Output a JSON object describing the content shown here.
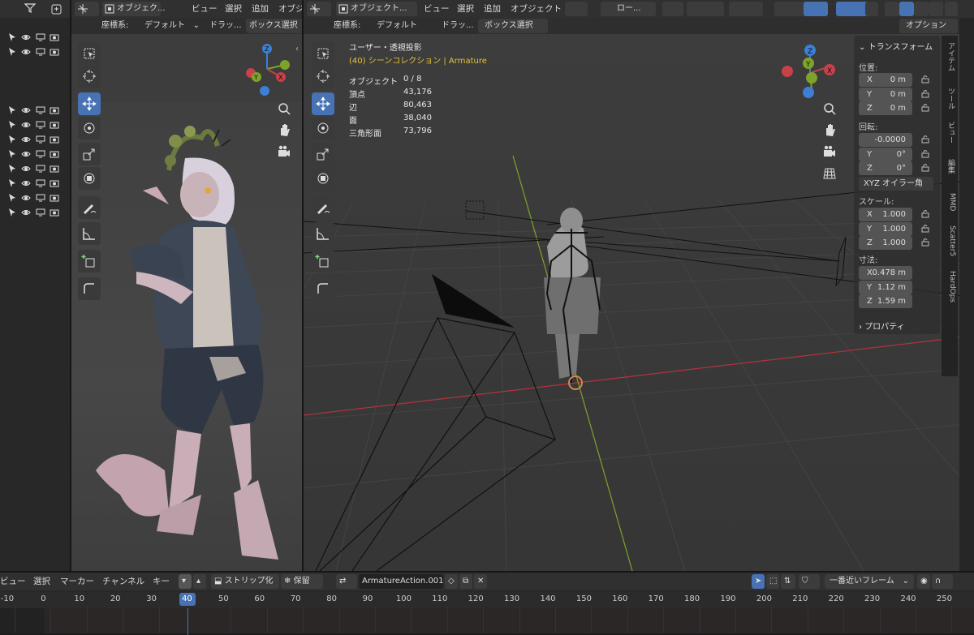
{
  "left_view": {
    "header": {
      "object_mode": "オブジェク...",
      "menu_view": "ビュー",
      "menu_select": "選択",
      "menu_add": "追加",
      "menu_object": "オブジ"
    },
    "tool_header": {
      "coord_label": "座標系:",
      "coord_value": "デフォルト",
      "drag_label": "ドラッ...",
      "drag_value": "ボックス選択"
    }
  },
  "right_view": {
    "header": {
      "object_mode": "オブジェクト...",
      "menu_view": "ビュー",
      "menu_select": "選択",
      "menu_add": "追加",
      "menu_object": "オブジェクト",
      "pivot": "ロー..."
    },
    "tool_header": {
      "coord_label": "座標系:",
      "coord_value": "デフォルト",
      "drag_label": "ドラッ...",
      "drag_value": "ボックス選択",
      "options": "オプション"
    },
    "overlay": {
      "view_name": "ユーザー・透視投影",
      "collection": "(40) シーンコレクション | Armature",
      "stats": [
        {
          "label": "オブジェクト",
          "value": "0 / 8"
        },
        {
          "label": "頂点",
          "value": "43,176"
        },
        {
          "label": "辺",
          "value": "80,463"
        },
        {
          "label": "面",
          "value": "38,040"
        },
        {
          "label": "三角形面",
          "value": "73,796"
        }
      ]
    }
  },
  "n_panel": {
    "transform_title": "トランスフォーム",
    "location_label": "位置:",
    "location": [
      {
        "axis": "X",
        "value": "0 m"
      },
      {
        "axis": "Y",
        "value": "0 m"
      },
      {
        "axis": "Z",
        "value": "0 m"
      }
    ],
    "rotation_label": "回転:",
    "rotation": [
      {
        "axis": "",
        "value": "-0.0000"
      },
      {
        "axis": "Y",
        "value": "0°"
      },
      {
        "axis": "Z",
        "value": "0°"
      }
    ],
    "rotation_mode": "XYZ オイラー角",
    "scale_label": "スケール:",
    "scale": [
      {
        "axis": "X",
        "value": "1.000"
      },
      {
        "axis": "Y",
        "value": "1.000"
      },
      {
        "axis": "Z",
        "value": "1.000"
      }
    ],
    "dimensions_label": "寸法:",
    "dimensions": [
      {
        "axis": "X",
        "value": "0.478 m"
      },
      {
        "axis": "Y",
        "value": "1.12 m"
      },
      {
        "axis": "Z",
        "value": "1.59 m"
      }
    ],
    "properties_label": "プロパティ"
  },
  "sidebar_tabs": [
    "アイテム",
    "ツール",
    "ビュー",
    "編集",
    "MMD",
    "Scatter5",
    "HardOps"
  ],
  "timeline": {
    "menus": [
      "ビュー",
      "選択",
      "マーカー",
      "チャンネル",
      "キー"
    ],
    "strip_label": "ストリップ化",
    "hold_label": "保留",
    "action_name": "ArmatureAction.001",
    "snap_mode": "一番近いフレーム",
    "current_frame": "40",
    "ticks": [
      "-10",
      "0",
      "10",
      "20",
      "30",
      "40",
      "50",
      "60",
      "70",
      "80",
      "90",
      "100",
      "110",
      "120",
      "130",
      "140",
      "150",
      "160",
      "170",
      "180",
      "190",
      "200",
      "210",
      "220",
      "230",
      "240",
      "250"
    ]
  },
  "colors": {
    "accent": "#4772b3",
    "frame_cursor": "#4772b3",
    "axis_x": "#c7404a",
    "axis_y": "#7ea32a",
    "axis_z": "#3b7fd8"
  }
}
